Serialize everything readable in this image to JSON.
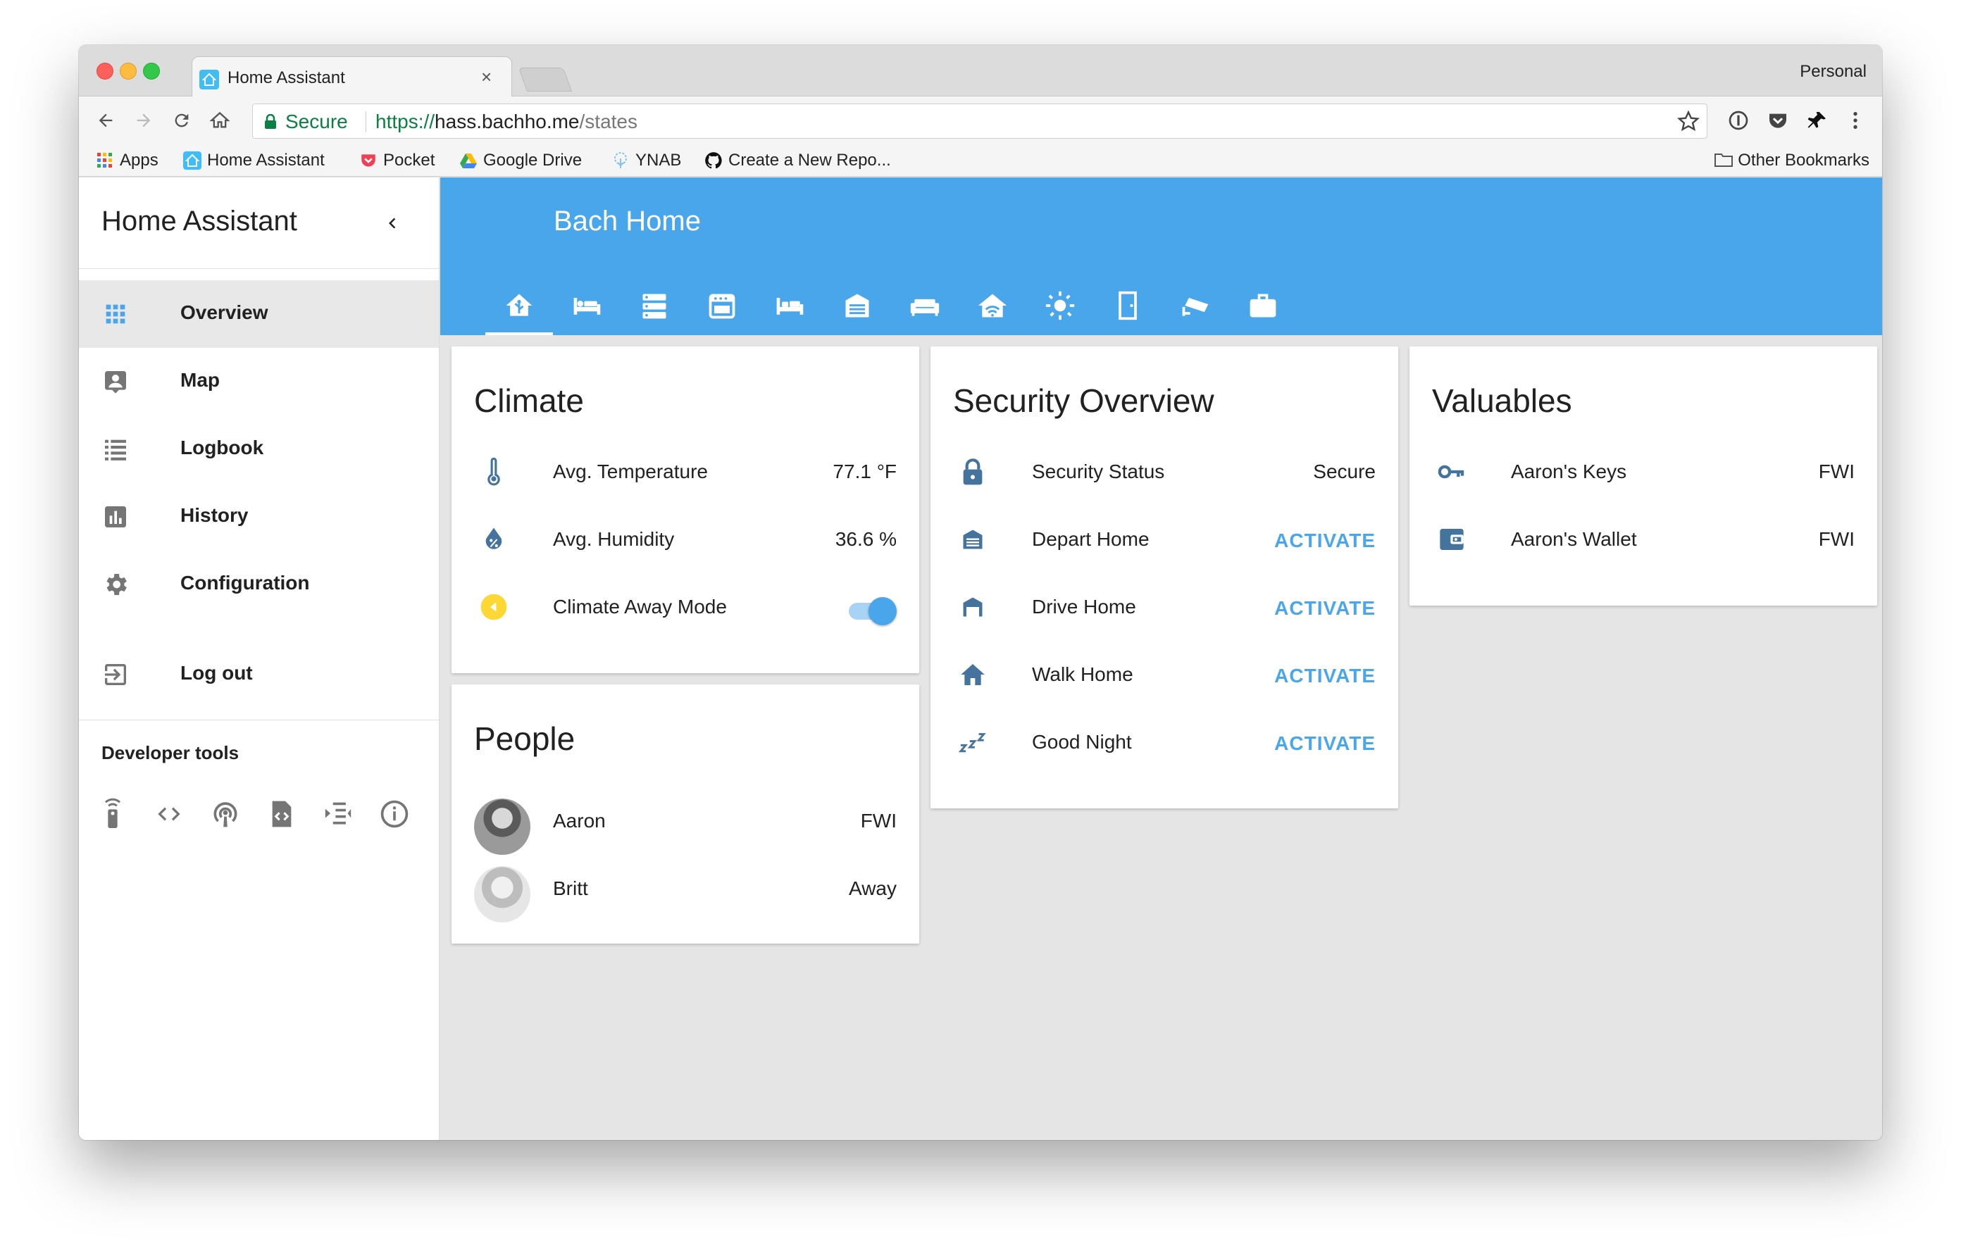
{
  "browser": {
    "tab_title": "Home Assistant",
    "tab_close": "×",
    "profile": "Personal",
    "secure_label": "Secure",
    "url_scheme": "https://",
    "url_host": "hass.bachho.me",
    "url_path": "/states",
    "bookmarks": [
      {
        "label": "Apps",
        "icon": "apps-grid-icon"
      },
      {
        "label": "Home Assistant",
        "icon": "home-assistant-icon"
      },
      {
        "label": "Pocket",
        "icon": "pocket-icon"
      },
      {
        "label": "Google Drive",
        "icon": "google-drive-icon"
      },
      {
        "label": "YNAB",
        "icon": "ynab-icon"
      },
      {
        "label": "Create a New Repo...",
        "icon": "github-icon"
      }
    ],
    "other_bookmarks": "Other Bookmarks"
  },
  "sidebar": {
    "title": "Home Assistant",
    "items": [
      {
        "label": "Overview",
        "icon": "grid-icon"
      },
      {
        "label": "Map",
        "icon": "map-account-icon"
      },
      {
        "label": "Logbook",
        "icon": "list-icon"
      },
      {
        "label": "History",
        "icon": "chart-icon"
      },
      {
        "label": "Configuration",
        "icon": "gear-icon"
      }
    ],
    "logout": "Log out",
    "dev_tools_title": "Developer tools",
    "dev_tools": [
      "remote-icon",
      "code-icon",
      "podcast-icon",
      "file-xml-icon",
      "format-indent-icon",
      "info-icon"
    ]
  },
  "header": {
    "title": "Bach Home",
    "tabs": [
      "home-icon",
      "bed-icon",
      "server-icon",
      "stove-icon",
      "bed-empty-icon",
      "garage-icon",
      "sofa-icon",
      "home-modern-icon",
      "weather-sunny-icon",
      "door-icon",
      "cctv-icon",
      "briefcase-icon"
    ]
  },
  "cards": {
    "climate": {
      "title": "Climate",
      "rows": [
        {
          "name": "Avg. Temperature",
          "value": "77.1 °F",
          "icon": "thermometer-icon"
        },
        {
          "name": "Avg. Humidity",
          "value": "36.6 %",
          "icon": "water-percent-icon"
        },
        {
          "name": "Climate Away Mode",
          "value": "on",
          "icon": "away-mode-icon"
        }
      ]
    },
    "people": {
      "title": "People",
      "rows": [
        {
          "name": "Aaron",
          "value": "FWI"
        },
        {
          "name": "Britt",
          "value": "Away"
        }
      ]
    },
    "security": {
      "title": "Security Overview",
      "rows": [
        {
          "name": "Security Status",
          "value": "Secure",
          "icon": "lock-icon"
        },
        {
          "name": "Depart Home",
          "action": "ACTIVATE",
          "icon": "garage-icon"
        },
        {
          "name": "Drive Home",
          "action": "ACTIVATE",
          "icon": "garage-open-icon"
        },
        {
          "name": "Walk Home",
          "action": "ACTIVATE",
          "icon": "home-icon"
        },
        {
          "name": "Good Night",
          "action": "ACTIVATE",
          "icon": "sleep-icon"
        }
      ]
    },
    "valuables": {
      "title": "Valuables",
      "rows": [
        {
          "name": "Aaron's Keys",
          "value": "FWI",
          "icon": "key-icon"
        },
        {
          "name": "Aaron's Wallet",
          "value": "FWI",
          "icon": "wallet-icon"
        }
      ]
    }
  },
  "colors": {
    "accent": "#4aa6eb",
    "icon": "#44739e",
    "away_mode": "#fdd835"
  }
}
